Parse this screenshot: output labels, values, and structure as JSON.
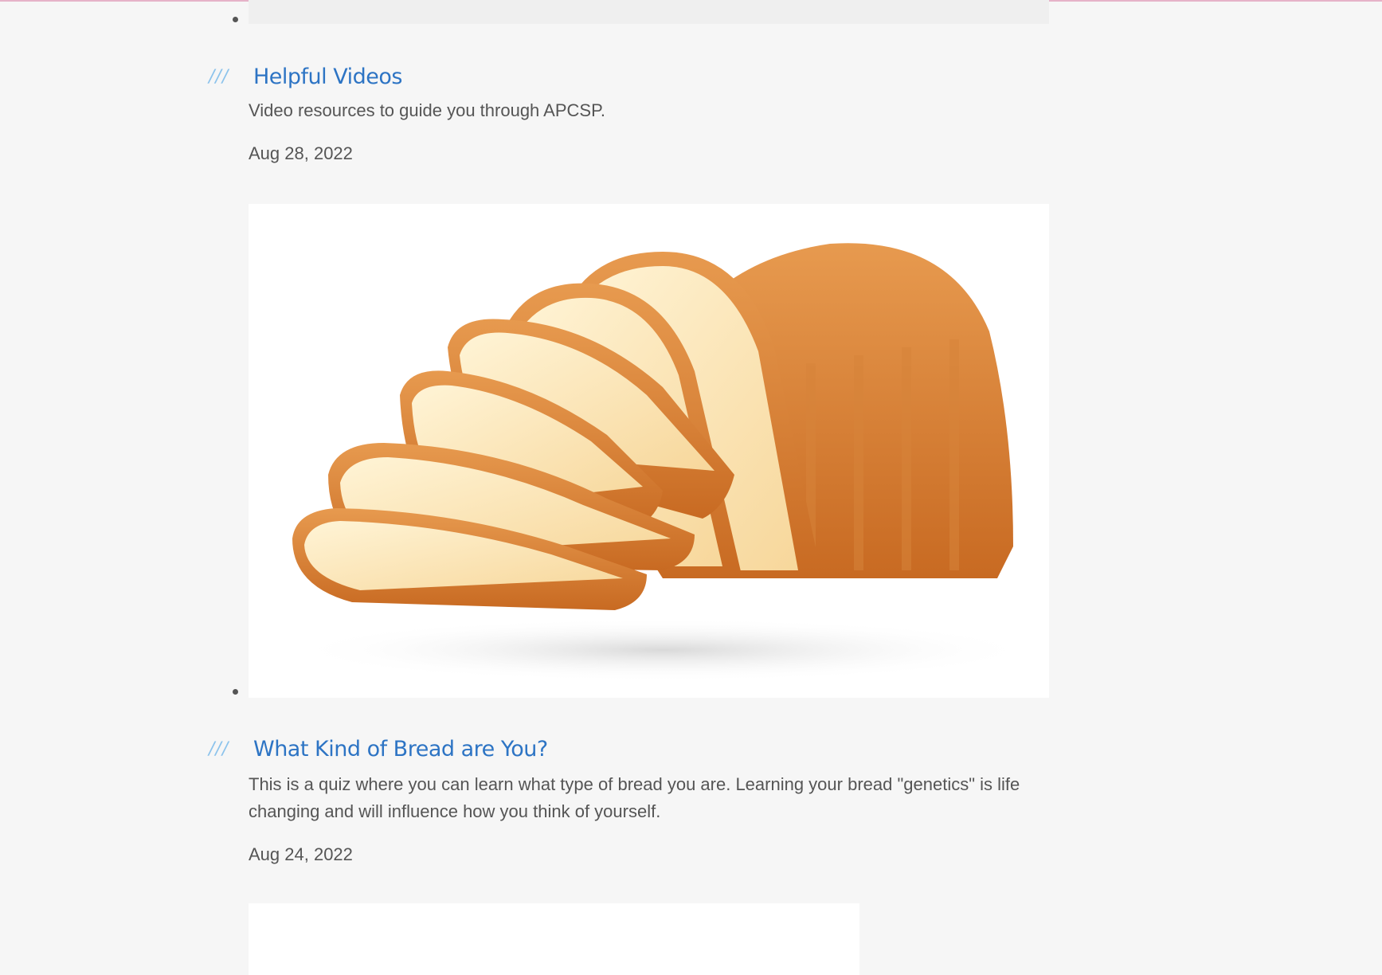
{
  "posts": [
    {
      "title": "Helpful Videos",
      "excerpt": "Video resources to guide you through APCSP.",
      "date": "Aug 28, 2022",
      "image": "bread-loaf"
    },
    {
      "title": "What Kind of Bread are You?",
      "excerpt": "This is a quiz where you can learn what type of bread you are. Learning your bread \"genetics\" is life changing and will influence how you think of yourself.",
      "date": "Aug 24, 2022",
      "image": "blank"
    }
  ],
  "title_marker": "///",
  "colors": {
    "title": "#2d74c4",
    "marker": "#8cc3ec",
    "text": "#555555",
    "background": "#f6f6f6",
    "top_border": "#e6b3c8"
  }
}
